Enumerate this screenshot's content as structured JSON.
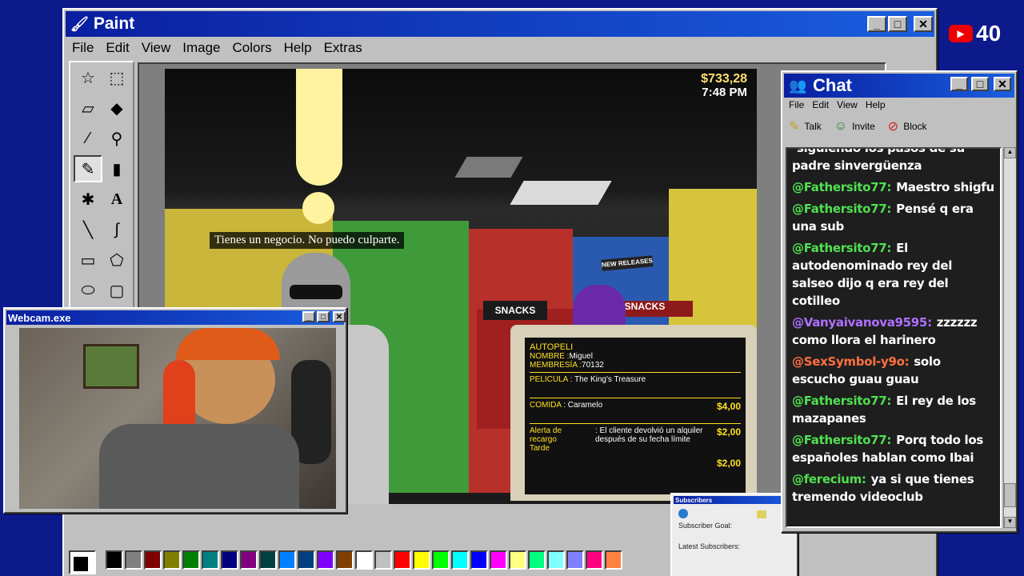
{
  "paint": {
    "title": "Paint",
    "menu": [
      "File",
      "Edit",
      "View",
      "Image",
      "Colors",
      "Help",
      "Extras"
    ],
    "palette": [
      "#000000",
      "#808080",
      "#800000",
      "#808000",
      "#008000",
      "#008080",
      "#000080",
      "#800080",
      "#004040",
      "#0080ff",
      "#004080",
      "#8000ff",
      "#804000",
      "#ffffff",
      "#c0c0c0",
      "#ff0000",
      "#ffff00",
      "#00ff00",
      "#00ffff",
      "#0000ff",
      "#ff00ff",
      "#ffff80",
      "#00ff80",
      "#80ffff",
      "#8080ff",
      "#ff0080",
      "#ff8040"
    ]
  },
  "game": {
    "money": "$733,28",
    "time": "7:48 PM",
    "subtitle": "Tienes un negocio. No puedo culparte.",
    "sign_new_releases": "NEW RELEASES",
    "sign_snacks": "SNACKS",
    "terminal": {
      "app": "AUTOPELI",
      "nombre_label": "NOMBRE :",
      "nombre": "Miguel",
      "membresia_label": "MEMBRESÍA :",
      "membresia": "70132",
      "pelicula_label": "PELICULA",
      "pelicula": ": The King's Treasure",
      "comida_label": "COMIDA",
      "comida": ": Caramelo",
      "comida_price": "$4,00",
      "alerta_label": "Alerta de recargo",
      "alerta_sub": "Tarde",
      "alerta_text": ": El cliente devolvió un alquiler después de su fecha límite",
      "alerta_price": "$2,00",
      "total": "$2,00"
    }
  },
  "webcam": {
    "title": "Webcam.exe"
  },
  "chat": {
    "title": "Chat",
    "menu": [
      "File",
      "Edit",
      "View",
      "Help"
    ],
    "tools": [
      "Talk",
      "Invite",
      "Block"
    ],
    "messages": [
      {
        "user": "",
        "text": "siguiendo los pasos de su padre sinvergüenza",
        "color": "#50e050"
      },
      {
        "user": "@Fathersito77:",
        "text": "Maestro shigfu",
        "color": "#50e050"
      },
      {
        "user": "@Fathersito77:",
        "text": "Pensé q era una sub",
        "color": "#50e050"
      },
      {
        "user": "@Fathersito77:",
        "text": "El autodenominado rey del salseo dijo q era rey del cotilleo",
        "color": "#50e050"
      },
      {
        "user": "@Vanyaivanova9595:",
        "text": "zzzzzz como llora el harinero",
        "color": "#b070ff"
      },
      {
        "user": "@SexSymbol-y9o:",
        "text": "solo escucho guau guau",
        "color": "#ff7040"
      },
      {
        "user": "@Fathersito77:",
        "text": "El rey de los mazapanes",
        "color": "#50e050"
      },
      {
        "user": "@Fathersito77:",
        "text": "Porq todo los españoles hablan como Ibai",
        "color": "#50e050"
      },
      {
        "user": "@ferecium:",
        "text": "ya si que tienes tremendo videoclub",
        "color": "#50e050"
      }
    ]
  },
  "subscribers": {
    "title": "Subscribers",
    "goal": "Subscriber Goal:",
    "latest": "Latest Subscribers:"
  },
  "youtube": {
    "count": "40"
  }
}
